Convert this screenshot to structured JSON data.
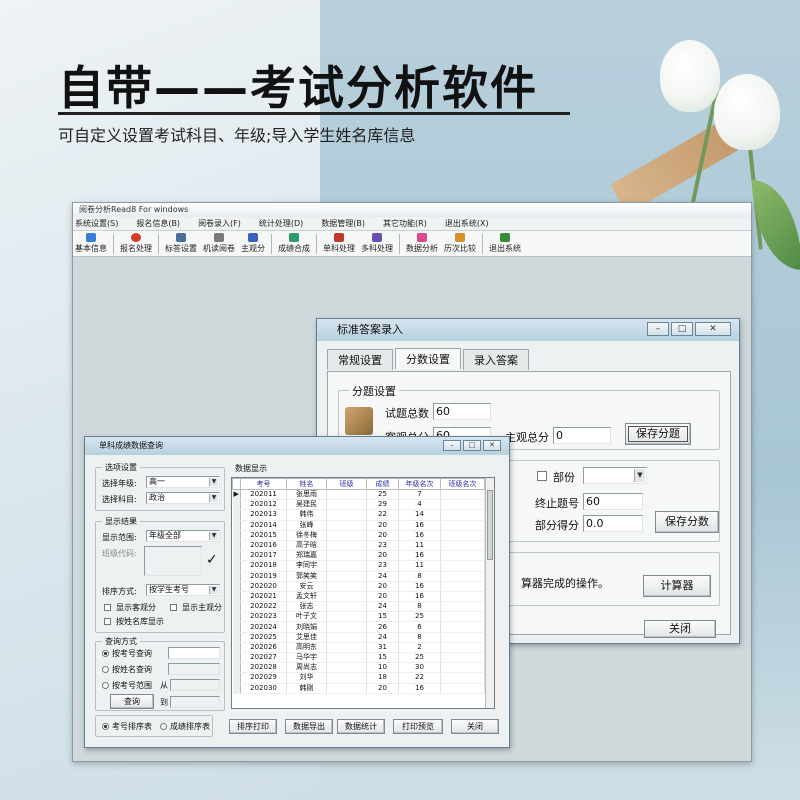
{
  "banner": {
    "headline": "自带——考试分析软件",
    "subline": "可自定义设置考试科目、年级;导入学生姓名库信息"
  },
  "app": {
    "title": "阅卷分析Read8 For windows",
    "menu": [
      "系统设置(S)",
      "报名信息(B)",
      "阅卷录入(F)",
      "统计处理(D)",
      "数据管理(B)",
      "其它功能(R)",
      "退出系统(X)"
    ],
    "toolbar": [
      {
        "label": "基本信息",
        "icon": "info-icon",
        "color": "#3a7bd5"
      },
      {
        "label": "报名处理",
        "icon": "apple-icon",
        "color": "#d83a2a"
      },
      {
        "label": "标答设置",
        "icon": "list-icon",
        "color": "#4a6f9a"
      },
      {
        "label": "机读阅卷",
        "icon": "scanner-icon",
        "color": "#7a7a7a"
      },
      {
        "label": "主观分",
        "icon": "network-icon",
        "color": "#3b5fbf"
      },
      {
        "label": "成绩合成",
        "icon": "merge-icon",
        "color": "#2a9a6a"
      },
      {
        "label": "单科处理",
        "icon": "single-icon",
        "color": "#c0392b"
      },
      {
        "label": "多科处理",
        "icon": "multi-icon",
        "color": "#6a4fb0"
      },
      {
        "label": "数据分析",
        "icon": "chart-icon",
        "color": "#d84a8a"
      },
      {
        "label": "历次比较",
        "icon": "compare-icon",
        "color": "#d8902a"
      },
      {
        "label": "退出系统",
        "icon": "exit-icon",
        "color": "#3a8a3a"
      }
    ]
  },
  "answer_window": {
    "title": "标准答案录入",
    "tabs": [
      "常规设置",
      "分数设置",
      "录入答案"
    ],
    "group_title": "分题设置",
    "total_questions_label": "试题总数",
    "total_questions_value": "60",
    "objective_label": "客观总分",
    "objective_value": "60",
    "subjective_label": "主观总分",
    "subjective_value": "0",
    "save_split_button": "保存分题",
    "part_label": "部份",
    "end_label": "终止题号",
    "end_value": "60",
    "part_score_label": "部分得分",
    "part_score_value": "0.0",
    "save_score_button": "保存分数",
    "calc_text": "算器完成的操作。",
    "calc_button": "计算器",
    "close_button": "关闭"
  },
  "score_window": {
    "title": "单科成绩数据查询",
    "options_title": "选项设置",
    "grade_label": "选择年级:",
    "grade_value": "高一",
    "subject_label": "选择科目:",
    "subject_value": "政治",
    "result_title": "显示结果",
    "range_label": "显示范围:",
    "range_value": "年级全部",
    "class_code_label": "班级代码:",
    "sort_label": "排序方式:",
    "sort_value": "按学生考号",
    "show_obj_label": "显示客观分",
    "show_subj_label": "显示主观分",
    "name_lib_label": "按姓名库显示",
    "query_title": "查询方式",
    "by_id_label": "按考号查询",
    "by_name_label": "按姓名查询",
    "by_range_label": "按考号范围",
    "from_label": "从",
    "to_label": "到",
    "query_button": "查询",
    "data_title": "数据显示",
    "columns": [
      "考号",
      "姓名",
      "班级",
      "成绩",
      "年级名次",
      "班级名次"
    ],
    "rows": [
      [
        "202011",
        "张思雨",
        "",
        "25",
        "7",
        ""
      ],
      [
        "202012",
        "吴建民",
        "",
        "29",
        "4",
        ""
      ],
      [
        "202013",
        "韩伟",
        "",
        "22",
        "14",
        ""
      ],
      [
        "202014",
        "张峰",
        "",
        "20",
        "16",
        ""
      ],
      [
        "202015",
        "徐冬梅",
        "",
        "20",
        "16",
        ""
      ],
      [
        "202016",
        "高子晗",
        "",
        "23",
        "11",
        ""
      ],
      [
        "202017",
        "郑瑞嘉",
        "",
        "20",
        "16",
        ""
      ],
      [
        "202018",
        "李同宇",
        "",
        "23",
        "11",
        ""
      ],
      [
        "202019",
        "郭笑笑",
        "",
        "24",
        "8",
        ""
      ],
      [
        "202020",
        "安云",
        "",
        "20",
        "16",
        ""
      ],
      [
        "202021",
        "孟文轩",
        "",
        "20",
        "16",
        ""
      ],
      [
        "202022",
        "张志",
        "",
        "24",
        "8",
        ""
      ],
      [
        "202023",
        "叶子文",
        "",
        "15",
        "25",
        ""
      ],
      [
        "202024",
        "刘晓娟",
        "",
        "26",
        "6",
        ""
      ],
      [
        "202025",
        "艾思佳",
        "",
        "24",
        "8",
        ""
      ],
      [
        "202026",
        "高明东",
        "",
        "31",
        "2",
        ""
      ],
      [
        "202027",
        "马华宇",
        "",
        "15",
        "25",
        ""
      ],
      [
        "202028",
        "周尚志",
        "",
        "10",
        "30",
        ""
      ],
      [
        "202029",
        "刘华",
        "",
        "18",
        "22",
        ""
      ],
      [
        "202030",
        "韩刚",
        "",
        "20",
        "16",
        ""
      ]
    ],
    "radio_by_id": "考号排序表",
    "radio_by_score": "成绩排序表",
    "print_sort_button": "排序打印",
    "export_button": "数据导出",
    "stats_button": "数据统计",
    "preview_button": "打印预览",
    "close_button": "关闭"
  }
}
